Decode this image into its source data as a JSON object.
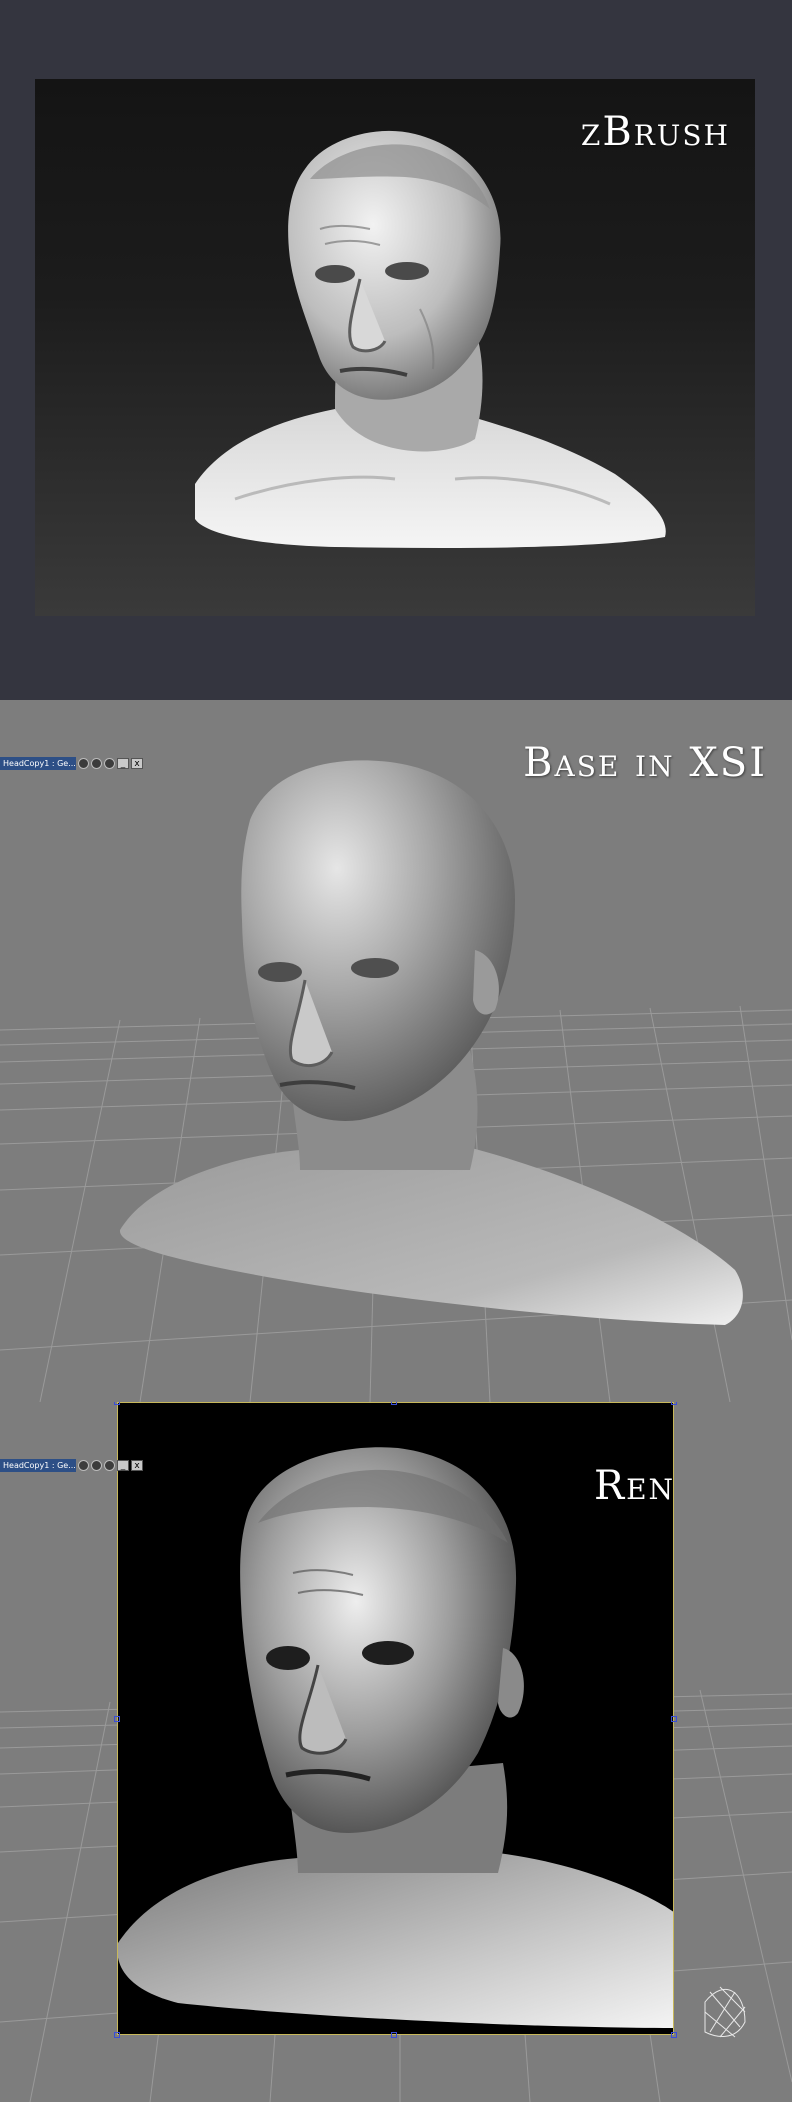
{
  "panels": [
    {
      "title": "zBrush"
    },
    {
      "title": "Base in XSI",
      "window_title": "HeadCopy1 : Ge...",
      "close_glyph": "x",
      "min_glyph": "_"
    },
    {
      "title": "Render",
      "window_title": "HeadCopy1 : Ge...",
      "close_glyph": "x",
      "min_glyph": "_"
    }
  ],
  "colors": {
    "page_bg": "#34353f",
    "viewport_bg": "#7d7d7d",
    "grid_line": "#9a9a9a",
    "selection_handle": "#3a4fd8",
    "render_frame_border": "#c8b85a",
    "title_bar": "#2d4f86"
  },
  "icons": [
    "shading-icon",
    "camera-icon",
    "info-icon",
    "minimize-icon",
    "close-icon"
  ]
}
